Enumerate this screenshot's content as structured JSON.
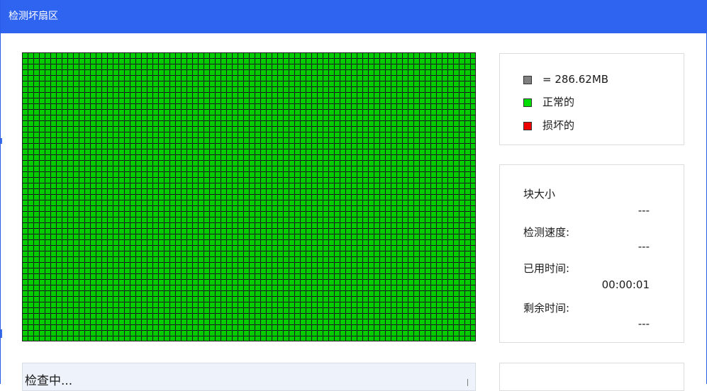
{
  "window": {
    "title": "检测坏扇区"
  },
  "legend": {
    "items": [
      {
        "label": "= 286.62MB",
        "color": "#808080",
        "icon": "gray-square-icon"
      },
      {
        "label": "正常的",
        "color": "#00dd00",
        "icon": "green-square-icon"
      },
      {
        "label": "损坏的",
        "color": "#ee0000",
        "icon": "red-square-icon"
      }
    ]
  },
  "stats": {
    "block_size_label": "块大小",
    "block_size_value": "---",
    "speed_label": "检测速度:",
    "speed_value": "---",
    "elapsed_label": "已用时间:",
    "elapsed_value": "00:00:01",
    "remaining_label": "剩余时间:",
    "remaining_value": "---"
  },
  "status": {
    "text": "检查中..."
  },
  "colors": {
    "titlebar": "#2f64f0",
    "normal_block": "#00cc00",
    "grid_line": "#1a1a1a"
  }
}
